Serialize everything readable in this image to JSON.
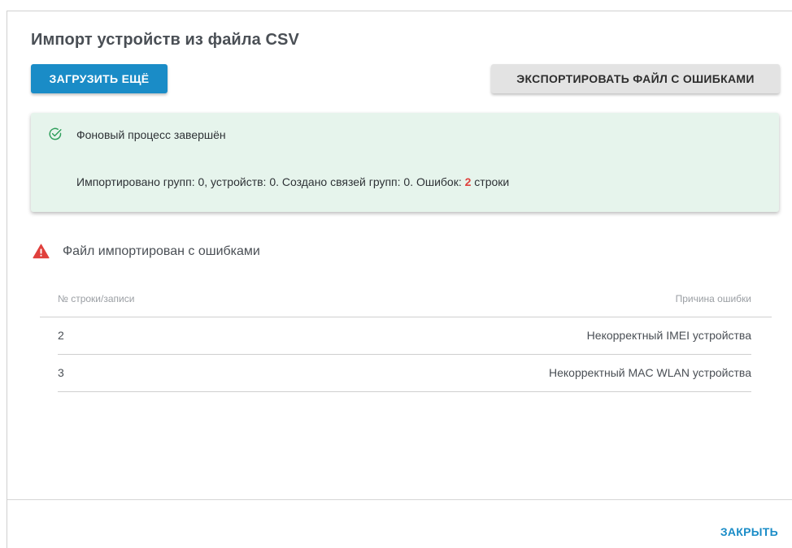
{
  "dialog": {
    "title": "Импорт устройств из файла CSV"
  },
  "toolbar": {
    "upload_more_label": "Загрузить ещё",
    "export_errors_label": "Экспортировать файл с ошибками"
  },
  "notice": {
    "icon": "check-circle-icon",
    "title": "Фоновый процесс завершён",
    "summary_prefix": "Импортировано групп: 0, устройств: 0. Создано связей групп: 0. Ошибок: ",
    "error_count": "2",
    "summary_suffix": " строки",
    "accent_color": "#2e9e5b",
    "background_color": "#e6f4ec"
  },
  "warning": {
    "icon": "warning-triangle-icon",
    "text": "Файл импортирован с ошибками",
    "color": "#e0403c"
  },
  "errors_table": {
    "columns": [
      "№ строки/записи",
      "Причина ошибки"
    ],
    "rows": [
      {
        "row": "2",
        "reason": "Некорректный IMEI устройства"
      },
      {
        "row": "3",
        "reason": "Некорректный MAC WLAN устройства"
      }
    ]
  },
  "footer": {
    "close_label": "Закрыть",
    "accent_color": "#1a8cc7"
  }
}
